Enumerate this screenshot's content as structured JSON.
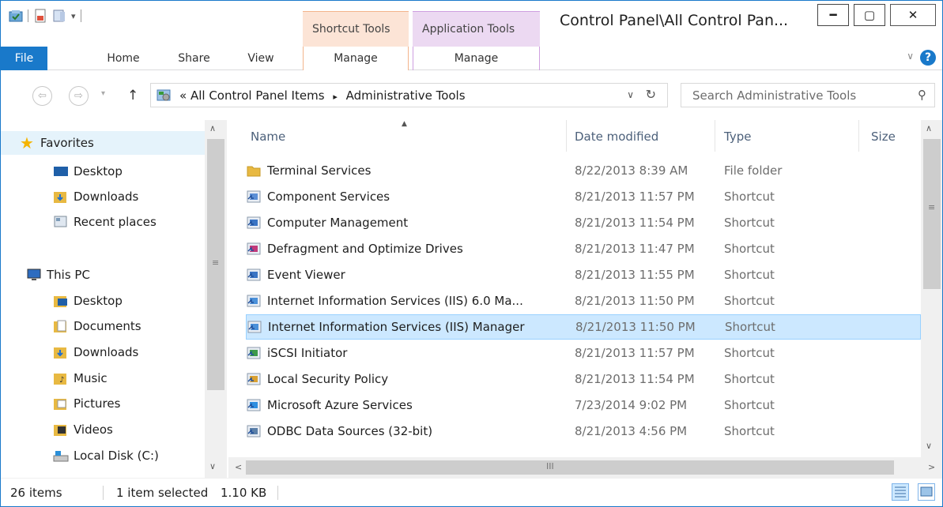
{
  "titlebar": {
    "title": "Control Panel\\All Control Pan...",
    "context_tabs": [
      "Shortcut Tools",
      "Application Tools"
    ]
  },
  "ribbon": {
    "tabs": [
      "File",
      "Home",
      "Share",
      "View",
      "Manage",
      "Manage"
    ],
    "help": "?"
  },
  "address": {
    "path_prefix": "«",
    "crumbs": [
      "All Control Panel Items",
      "Administrative Tools"
    ],
    "separator": "▸",
    "search_placeholder": "Search Administrative Tools"
  },
  "nav": {
    "favorites": {
      "label": "Favorites",
      "items": [
        "Desktop",
        "Downloads",
        "Recent places"
      ]
    },
    "thispc": {
      "label": "This PC",
      "items": [
        "Desktop",
        "Documents",
        "Downloads",
        "Music",
        "Pictures",
        "Videos",
        "Local Disk (C:)"
      ]
    }
  },
  "columns": [
    "Name",
    "Date modified",
    "Type",
    "Size"
  ],
  "files": [
    {
      "name": "Terminal Services",
      "date": "8/22/2013 8:39 AM",
      "type": "File folder",
      "icon": "folder-icon"
    },
    {
      "name": "Component Services",
      "date": "8/21/2013 11:57 PM",
      "type": "Shortcut",
      "icon": "component-services-icon"
    },
    {
      "name": "Computer Management",
      "date": "8/21/2013 11:54 PM",
      "type": "Shortcut",
      "icon": "computer-management-icon"
    },
    {
      "name": "Defragment and Optimize Drives",
      "date": "8/21/2013 11:47 PM",
      "type": "Shortcut",
      "icon": "defragment-icon"
    },
    {
      "name": "Event Viewer",
      "date": "8/21/2013 11:55 PM",
      "type": "Shortcut",
      "icon": "event-viewer-icon"
    },
    {
      "name": "Internet Information Services (IIS) 6.0 Ma...",
      "date": "8/21/2013 11:50 PM",
      "type": "Shortcut",
      "icon": "iis6-icon"
    },
    {
      "name": "Internet Information Services (IIS) Manager",
      "date": "8/21/2013 11:50 PM",
      "type": "Shortcut",
      "icon": "iis-manager-icon",
      "selected": true
    },
    {
      "name": "iSCSI Initiator",
      "date": "8/21/2013 11:57 PM",
      "type": "Shortcut",
      "icon": "iscsi-icon"
    },
    {
      "name": "Local Security Policy",
      "date": "8/21/2013 11:54 PM",
      "type": "Shortcut",
      "icon": "security-policy-icon"
    },
    {
      "name": "Microsoft Azure Services",
      "date": "7/23/2014 9:02 PM",
      "type": "Shortcut",
      "icon": "azure-icon"
    },
    {
      "name": "ODBC Data Sources (32-bit)",
      "date": "8/21/2013 4:56 PM",
      "type": "Shortcut",
      "icon": "odbc-icon"
    }
  ],
  "status": {
    "count": "26 items",
    "selection": "1 item selected",
    "size": "1.10 KB"
  },
  "colors": {
    "accent": "#1979ca",
    "selection": "#cce8ff",
    "shortcut_tools": "#fce4d6",
    "application_tools": "#ecd9f2"
  }
}
